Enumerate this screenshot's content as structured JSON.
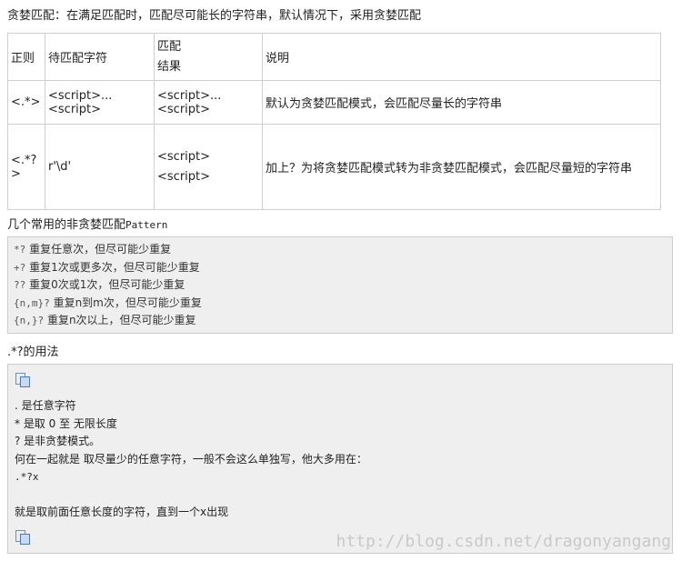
{
  "title": "贪婪匹配：在满足匹配时，匹配尽可能长的字符串，默认情况下，采用贪婪匹配",
  "table": {
    "headers": [
      "正则",
      "待匹配字符",
      "匹配\n结果",
      "说明"
    ],
    "rows": [
      {
        "pattern": "<.*>",
        "input": "<script>...<script>",
        "result": "<script>...<script>",
        "desc": "默认为贪婪匹配模式，会匹配尽量长的字符串"
      },
      {
        "pattern": "<.*?>",
        "input": "r'\\d'",
        "result": "<script>\n<script>",
        "desc": "加上？为将贪婪匹配模式转为非贪婪匹配模式，会匹配尽量短的字符串"
      }
    ]
  },
  "section2": {
    "title_text": "几个常用的非贪婪匹配",
    "title_code": "Pattern",
    "lines": [
      {
        "code": "*?",
        "text": " 重复任意次，但尽可能少重复"
      },
      {
        "code": "+?",
        "text": " 重复1次或更多次，但尽可能少重复"
      },
      {
        "code": "??",
        "text": " 重复0次或1次，但尽可能少重复"
      },
      {
        "code": "{n,m}?",
        "text": " 重复n到m次，但尽可能少重复"
      },
      {
        "code": "{n,}?",
        "text": " 重复n次以上，但尽可能少重复"
      }
    ]
  },
  "section3": {
    "title": ".*?的用法",
    "lines": [
      ". 是任意字符",
      "* 是取 0 至 无限长度",
      "? 是非贪婪模式。",
      "何在一起就是 取尽量少的任意字符，一般不会这么单独写，他大多用在：",
      ".*?x",
      "",
      "就是取前面任意长度的字符，直到一个x出现"
    ]
  },
  "watermark": "http://blog.csdn.net/dragonyangang",
  "icons": {
    "copy": "copy-icon"
  }
}
